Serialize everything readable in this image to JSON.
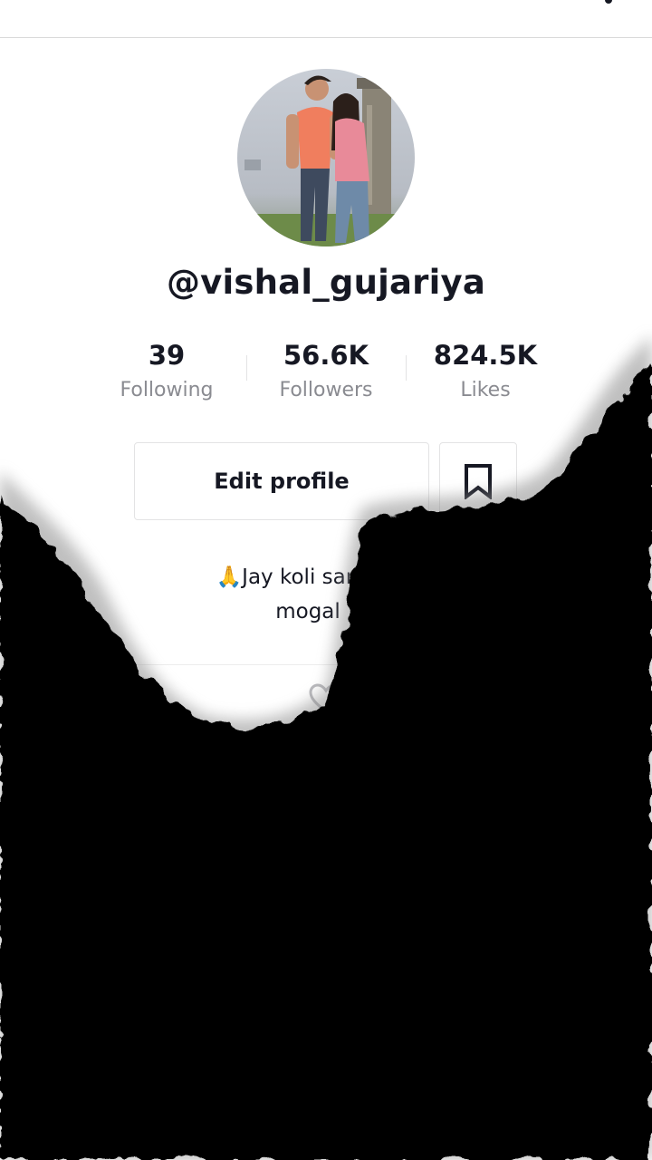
{
  "profile": {
    "username": "@vishal_gujariya",
    "stats": {
      "following": {
        "value": "39",
        "label": "Following"
      },
      "followers": {
        "value": "56.6K",
        "label": "Followers"
      },
      "likes": {
        "value": "824.5K",
        "label": "Likes"
      }
    },
    "edit_button_label": "Edit profile",
    "bio_line1": "🙏Jay koli samaj 🙏Ja",
    "bio_line2": "mogal"
  },
  "icons": {
    "header_add": "add-user-icon",
    "header_menu": "more-menu-icon",
    "bookmark": "bookmark-icon",
    "liked_tab": "heart-icon"
  },
  "colors": {
    "text_primary": "#161823",
    "text_secondary": "#8a8b91",
    "border": "#e3e3e4",
    "overlay": "#000000"
  }
}
